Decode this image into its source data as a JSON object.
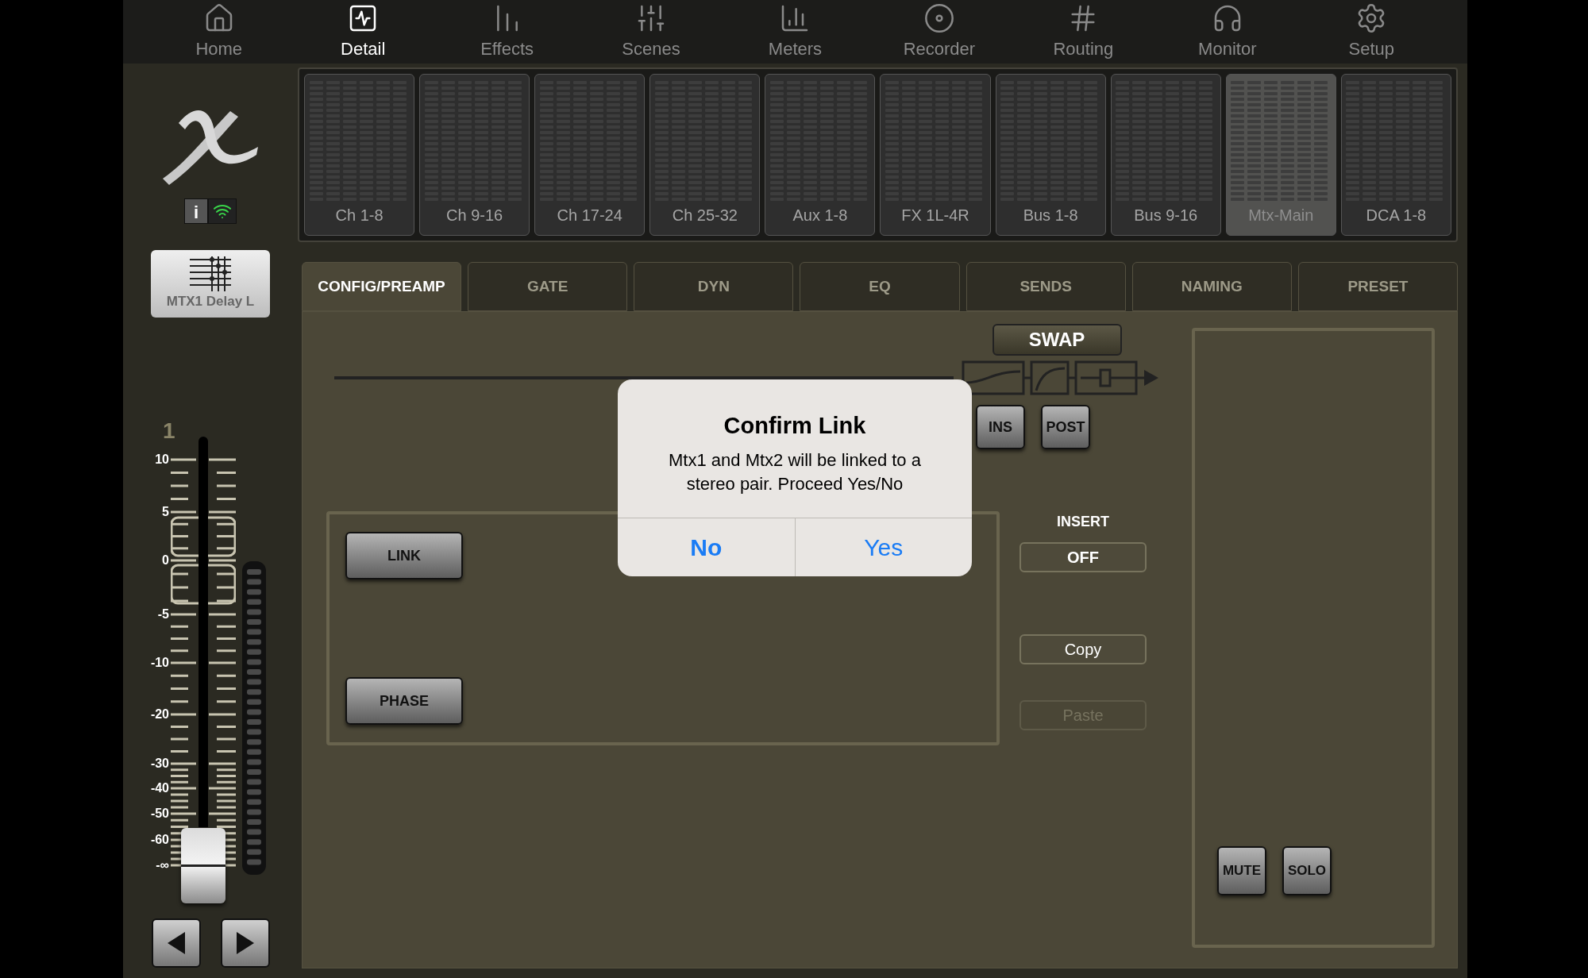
{
  "nav": [
    {
      "label": "Home",
      "selected": false
    },
    {
      "label": "Detail",
      "selected": true
    },
    {
      "label": "Effects",
      "selected": false
    },
    {
      "label": "Scenes",
      "selected": false
    },
    {
      "label": "Meters",
      "selected": false
    },
    {
      "label": "Recorder",
      "selected": false
    },
    {
      "label": "Routing",
      "selected": false
    },
    {
      "label": "Monitor",
      "selected": false
    },
    {
      "label": "Setup",
      "selected": false
    }
  ],
  "info_label": "i",
  "banks": [
    {
      "label": "Ch 1-8",
      "selected": false
    },
    {
      "label": "Ch 9-16",
      "selected": false
    },
    {
      "label": "Ch 17-24",
      "selected": false
    },
    {
      "label": "Ch 25-32",
      "selected": false
    },
    {
      "label": "Aux 1-8",
      "selected": false
    },
    {
      "label": "FX 1L-4R",
      "selected": false
    },
    {
      "label": "Bus 1-8",
      "selected": false
    },
    {
      "label": "Bus 9-16",
      "selected": false
    },
    {
      "label": "Mtx-Main",
      "selected": true
    },
    {
      "label": "DCA 1-8",
      "selected": false
    }
  ],
  "strip": {
    "name": "MTX1 Delay L",
    "number": "1",
    "scale": [
      "10",
      "5",
      "0",
      "-5",
      "-10",
      "-20",
      "-30",
      "-40",
      "-50",
      "-60",
      "-∞"
    ]
  },
  "tabs": [
    {
      "label": "CONFIG/PREAMP",
      "selected": true
    },
    {
      "label": "GATE",
      "selected": false
    },
    {
      "label": "DYN",
      "selected": false
    },
    {
      "label": "EQ",
      "selected": false
    },
    {
      "label": "SENDS",
      "selected": false
    },
    {
      "label": "NAMING",
      "selected": false
    },
    {
      "label": "PRESET",
      "selected": false
    }
  ],
  "swap": "SWAP",
  "ins": "INS",
  "post": "POST",
  "link": "LINK",
  "phase": "PHASE",
  "insert": {
    "label": "INSERT",
    "value": "OFF"
  },
  "clipboard": [
    {
      "label": "Copy",
      "disabled": false
    },
    {
      "label": "Paste",
      "disabled": true
    }
  ],
  "mute": "MUTE",
  "solo": "SOLO",
  "dialog": {
    "title": "Confirm Link",
    "message": "Mtx1 and Mtx2 will be linked to a stereo pair. Proceed Yes/No",
    "buttons": [
      {
        "label": "No",
        "default": true
      },
      {
        "label": "Yes",
        "default": false
      }
    ]
  }
}
